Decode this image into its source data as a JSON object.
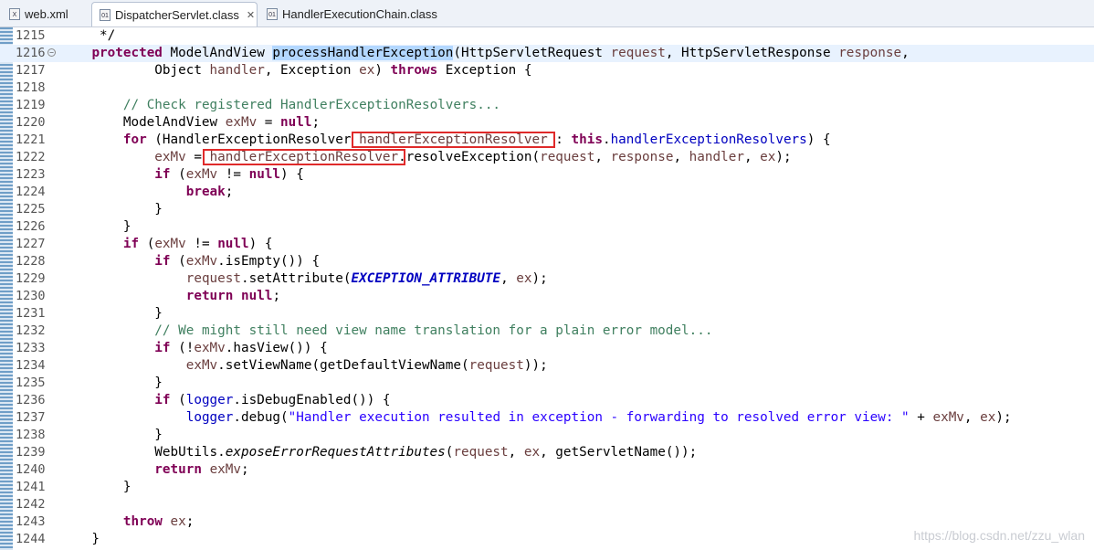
{
  "tabs": [
    {
      "label": "web.xml",
      "icon": "xml-file-icon"
    },
    {
      "label": "DispatcherServlet.class",
      "icon": "class-file-icon",
      "close": "✕"
    },
    {
      "label": "HandlerExecutionChain.class",
      "icon": "class-file-icon"
    }
  ],
  "watermark": "https://blog.csdn.net/zzu_wlan",
  "code_lines": [
    {
      "n": "1215",
      "tokens": [
        [
          "",
          "     */"
        ]
      ]
    },
    {
      "n": "1216",
      "fold": "−",
      "current": true,
      "tokens": [
        [
          "",
          "    "
        ],
        [
          "kw",
          "protected"
        ],
        [
          "",
          " ModelAndView "
        ],
        [
          "hl",
          "processHandlerException"
        ],
        [
          "",
          "(HttpServletRequest "
        ],
        [
          "pa",
          "request"
        ],
        [
          "",
          ", HttpServletResponse "
        ],
        [
          "pa",
          "response"
        ],
        [
          "",
          ","
        ]
      ]
    },
    {
      "n": "1217",
      "tokens": [
        [
          "",
          "            Object "
        ],
        [
          "pa",
          "handler"
        ],
        [
          "",
          ", Exception "
        ],
        [
          "pa",
          "ex"
        ],
        [
          "",
          ") "
        ],
        [
          "kw",
          "throws"
        ],
        [
          "",
          " Exception {"
        ]
      ]
    },
    {
      "n": "1218",
      "tokens": [
        [
          "",
          ""
        ]
      ]
    },
    {
      "n": "1219",
      "tokens": [
        [
          "",
          "        "
        ],
        [
          "cm",
          "// Check registered HandlerExceptionResolvers..."
        ]
      ]
    },
    {
      "n": "1220",
      "tokens": [
        [
          "",
          "        ModelAndView "
        ],
        [
          "pa",
          "exMv"
        ],
        [
          "",
          " = "
        ],
        [
          "kw",
          "null"
        ],
        [
          "",
          ";"
        ]
      ]
    },
    {
      "n": "1221",
      "tokens": [
        [
          "",
          "        "
        ],
        [
          "kw",
          "for"
        ],
        [
          "",
          " (HandlerExceptionResolver "
        ],
        [
          "pa",
          "handlerExceptionResolver"
        ],
        [
          "",
          " : "
        ],
        [
          "kw",
          "this"
        ],
        [
          "",
          "."
        ],
        [
          "fd",
          "handlerExceptionResolvers"
        ],
        [
          "",
          ") {"
        ]
      ]
    },
    {
      "n": "1222",
      "tokens": [
        [
          "",
          "            "
        ],
        [
          "pa",
          "exMv"
        ],
        [
          "",
          " = "
        ],
        [
          "pa",
          "handlerExceptionResolver"
        ],
        [
          "",
          ".resolveException("
        ],
        [
          "pa",
          "request"
        ],
        [
          "",
          ", "
        ],
        [
          "pa",
          "response"
        ],
        [
          "",
          ", "
        ],
        [
          "pa",
          "handler"
        ],
        [
          "",
          ", "
        ],
        [
          "pa",
          "ex"
        ],
        [
          "",
          ");"
        ]
      ]
    },
    {
      "n": "1223",
      "tokens": [
        [
          "",
          "            "
        ],
        [
          "kw",
          "if"
        ],
        [
          "",
          " ("
        ],
        [
          "pa",
          "exMv"
        ],
        [
          "",
          " != "
        ],
        [
          "kw",
          "null"
        ],
        [
          "",
          ") {"
        ]
      ]
    },
    {
      "n": "1224",
      "tokens": [
        [
          "",
          "                "
        ],
        [
          "kw",
          "break"
        ],
        [
          "",
          ";"
        ]
      ]
    },
    {
      "n": "1225",
      "tokens": [
        [
          "",
          "            }"
        ]
      ]
    },
    {
      "n": "1226",
      "tokens": [
        [
          "",
          "        }"
        ]
      ]
    },
    {
      "n": "1227",
      "tokens": [
        [
          "",
          "        "
        ],
        [
          "kw",
          "if"
        ],
        [
          "",
          " ("
        ],
        [
          "pa",
          "exMv"
        ],
        [
          "",
          " != "
        ],
        [
          "kw",
          "null"
        ],
        [
          "",
          ") {"
        ]
      ]
    },
    {
      "n": "1228",
      "tokens": [
        [
          "",
          "            "
        ],
        [
          "kw",
          "if"
        ],
        [
          "",
          " ("
        ],
        [
          "pa",
          "exMv"
        ],
        [
          "",
          ".isEmpty()) {"
        ]
      ]
    },
    {
      "n": "1229",
      "tokens": [
        [
          "",
          "                "
        ],
        [
          "pa",
          "request"
        ],
        [
          "",
          ".setAttribute("
        ],
        [
          "cs",
          "EXCEPTION_ATTRIBUTE"
        ],
        [
          "",
          ", "
        ],
        [
          "pa",
          "ex"
        ],
        [
          "",
          ");"
        ]
      ]
    },
    {
      "n": "1230",
      "tokens": [
        [
          "",
          "                "
        ],
        [
          "kw",
          "return"
        ],
        [
          "",
          " "
        ],
        [
          "kw",
          "null"
        ],
        [
          "",
          ";"
        ]
      ]
    },
    {
      "n": "1231",
      "tokens": [
        [
          "",
          "            }"
        ]
      ]
    },
    {
      "n": "1232",
      "tokens": [
        [
          "",
          "            "
        ],
        [
          "cm",
          "// We might still need view name translation for a plain error model..."
        ]
      ]
    },
    {
      "n": "1233",
      "tokens": [
        [
          "",
          "            "
        ],
        [
          "kw",
          "if"
        ],
        [
          "",
          " (!"
        ],
        [
          "pa",
          "exMv"
        ],
        [
          "",
          ".hasView()) {"
        ]
      ]
    },
    {
      "n": "1234",
      "tokens": [
        [
          "",
          "                "
        ],
        [
          "pa",
          "exMv"
        ],
        [
          "",
          ".setViewName(getDefaultViewName("
        ],
        [
          "pa",
          "request"
        ],
        [
          "",
          "));"
        ]
      ]
    },
    {
      "n": "1235",
      "tokens": [
        [
          "",
          "            }"
        ]
      ]
    },
    {
      "n": "1236",
      "tokens": [
        [
          "",
          "            "
        ],
        [
          "kw",
          "if"
        ],
        [
          "",
          " ("
        ],
        [
          "fd",
          "logger"
        ],
        [
          "",
          ".isDebugEnabled()) {"
        ]
      ]
    },
    {
      "n": "1237",
      "tokens": [
        [
          "",
          "                "
        ],
        [
          "fd",
          "logger"
        ],
        [
          "",
          ".debug("
        ],
        [
          "st",
          "\"Handler execution resulted in exception - forwarding to resolved error view: \""
        ],
        [
          "",
          " + "
        ],
        [
          "pa",
          "exMv"
        ],
        [
          "",
          ", "
        ],
        [
          "pa",
          "ex"
        ],
        [
          "",
          ");"
        ]
      ]
    },
    {
      "n": "1238",
      "tokens": [
        [
          "",
          "            }"
        ]
      ]
    },
    {
      "n": "1239",
      "tokens": [
        [
          "",
          "            WebUtils."
        ],
        [
          "it",
          "exposeErrorRequestAttributes"
        ],
        [
          "",
          "("
        ],
        [
          "pa",
          "request"
        ],
        [
          "",
          ", "
        ],
        [
          "pa",
          "ex"
        ],
        [
          "",
          ", getServletName());"
        ]
      ]
    },
    {
      "n": "1240",
      "tokens": [
        [
          "",
          "            "
        ],
        [
          "kw",
          "return"
        ],
        [
          "",
          " "
        ],
        [
          "pa",
          "exMv"
        ],
        [
          "",
          ";"
        ]
      ]
    },
    {
      "n": "1241",
      "tokens": [
        [
          "",
          "        }"
        ]
      ]
    },
    {
      "n": "1242",
      "tokens": [
        [
          "",
          ""
        ]
      ]
    },
    {
      "n": "1243",
      "tokens": [
        [
          "",
          "        "
        ],
        [
          "kw",
          "throw"
        ],
        [
          "",
          " "
        ],
        [
          "pa",
          "ex"
        ],
        [
          "",
          ";"
        ]
      ]
    },
    {
      "n": "1244",
      "tokens": [
        [
          "",
          "    }"
        ]
      ]
    }
  ]
}
